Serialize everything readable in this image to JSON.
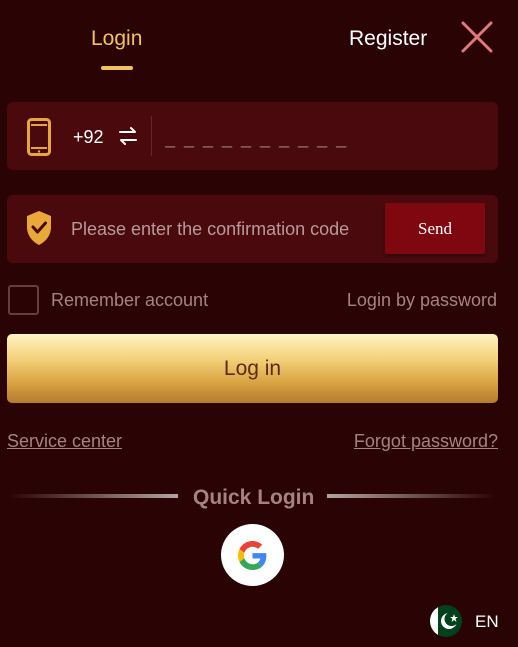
{
  "tabs": {
    "login_label": "Login",
    "register_label": "Register"
  },
  "phone": {
    "country_code": "+92",
    "placeholder": "_ _ _ _ _ _ _ _ _ _"
  },
  "code": {
    "placeholder": "Please enter the confirmation code",
    "send_label": "Send"
  },
  "options": {
    "remember_label": "Remember account",
    "login_by_password_label": "Login by password"
  },
  "login_button_label": "Log in",
  "links": {
    "service_center": "Service center",
    "forgot_password": "Forgot password?"
  },
  "quick_login": {
    "label": "Quick Login",
    "providers": [
      "google-icon"
    ]
  },
  "language": {
    "label": "EN",
    "flag": "pakistan-flag-icon"
  },
  "colors": {
    "background": "#2a0305",
    "field_background": "#4a0a0d",
    "accent_gold": "#f0c45a",
    "send_button": "#7e0710",
    "muted_text": "#a88283"
  }
}
